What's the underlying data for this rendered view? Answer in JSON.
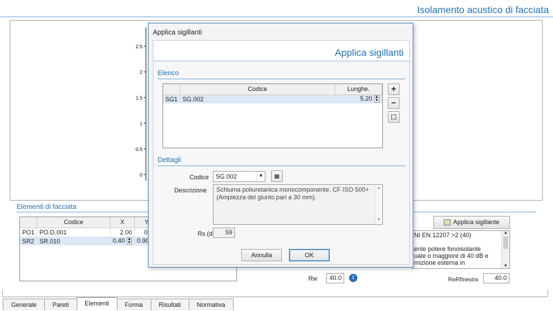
{
  "app": {
    "title": "Isolamento acustico di facciata"
  },
  "chart": {
    "y_ticks": [
      "2.5",
      "2",
      "1.5",
      "1",
      "0.5",
      "0"
    ]
  },
  "chart_data": {
    "type": "line",
    "ylim": [
      0,
      2.5
    ],
    "ticks": [
      2.5,
      2,
      1.5,
      1,
      0.5,
      0
    ],
    "series": []
  },
  "elementi": {
    "section_title": "Elementi di facciata",
    "columns": [
      "",
      "Codice",
      "X",
      "Y"
    ],
    "rows": [
      {
        "id": "PO1",
        "codice": "PO.D.001",
        "x": "2.00",
        "y": "0.00"
      },
      {
        "id": "SR2",
        "codice": "SR.010",
        "x": "0.40",
        "y": "0.90"
      }
    ]
  },
  "right_panel": {
    "apply_button": "Applica sigillante",
    "note_lines": [
      "NI EN 12207 >2  (40)",
      "",
      "ente potere fonoisolante",
      "uale o maggiore di 40 dB e",
      "rnizione esterna in"
    ]
  },
  "results": {
    "rw_label": "Rw",
    "rw_value": "40.0",
    "rwf_label": "RwRfinestra",
    "rwf_value": "40.0"
  },
  "tabs": [
    "Generale",
    "Pareti",
    "Elementi",
    "Forma",
    "Risultati",
    "Normativa"
  ],
  "dialog": {
    "caption": "Applica sigillanti",
    "header_title": "Applica sigillanti",
    "elenco": {
      "title": "Elenco",
      "columns": [
        "",
        "Codice",
        "Lunghe."
      ],
      "rows": [
        {
          "id": "SG1",
          "codice": "SG.002",
          "lungh": "5.20"
        }
      ]
    },
    "dettagli": {
      "title": "Dettagli",
      "codice_label": "Codice",
      "codice_value": "SG.002",
      "descrizione_label": "Descrizione",
      "descrizione_value": "Schiuma poliuretanica monocomponente. CF ISO 500+ (Ampiezza del giunto pari a 30 mm).",
      "rs_label": "Rs (dB)",
      "rs_value": "59"
    },
    "cancel_label": "Annulla",
    "ok_label": "OK"
  }
}
